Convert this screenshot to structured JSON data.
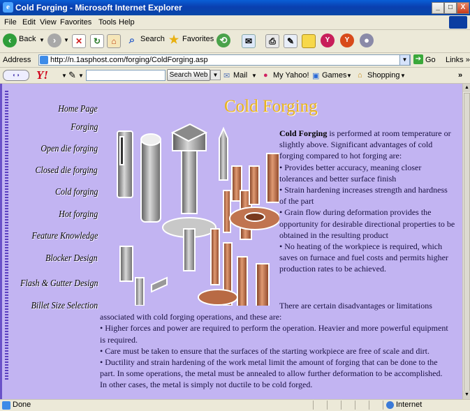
{
  "window": {
    "title": "Cold Forging - Microsoft Internet Explorer",
    "minimize": "_",
    "maximize": "□",
    "close": "X"
  },
  "menu": [
    "File",
    "Edit",
    "View",
    "Favorites",
    "Tools",
    "Help"
  ],
  "toolbar": {
    "back": "Back",
    "search": "Search",
    "favorites": "Favorites"
  },
  "address": {
    "label": "Address",
    "url": "http://n.1asphost.com/forging/ColdForging.asp",
    "go": "Go",
    "links": "Links »"
  },
  "yahoo": {
    "logo": "Y!",
    "search_button": "Search Web",
    "mail": "Mail",
    "my_yahoo": "My Yahoo!",
    "games": "Games",
    "shopping": "Shopping",
    "more": "»"
  },
  "page": {
    "heading": "Cold Forging",
    "nav": [
      "Home Page",
      "Forging",
      "Open die forging",
      "Closed die forging",
      "Cold forging",
      "Hot forging",
      "Feature Knowledge",
      "Blocker Design",
      "Flash & Gutter Design",
      "Billet Size Selection"
    ],
    "intro_bold": "Cold Forging",
    "intro_rest": " is performed at room temperature or slightly above. Significant advantages of cold forging compared to hot forging are:",
    "advantages": [
      "• Provides better accuracy, meaning closer tolerances and better surface finish",
      "• Strain hardening increases strength and hardness of the part",
      "• Grain flow during deformation provides the opportunity for desirable directional properties to be obtained in the resulting product",
      "• No heating of the workpiece is required, which saves on furnace and fuel costs and permits higher production rates to be achieved."
    ],
    "disadvantages_intro": "There are certain disadvantages or limitations associated with cold forging operations, and these are:",
    "disadvantages": [
      "• Higher forces and power are required to perform the operation. Heavier and more powerful equipment is required.",
      "• Care must be taken to ensure that the surfaces of the starting workpiece are free of scale and dirt.",
      "• Ductility and strain hardening of the work metal limit the amount of forging that can be done to the part. In some operations, the metal must be annealed to allow further deformation to be accomplished. In other cases, the metal is simply not ductile to be cold forged."
    ]
  },
  "status": {
    "text": "Done",
    "zone": "Internet"
  }
}
